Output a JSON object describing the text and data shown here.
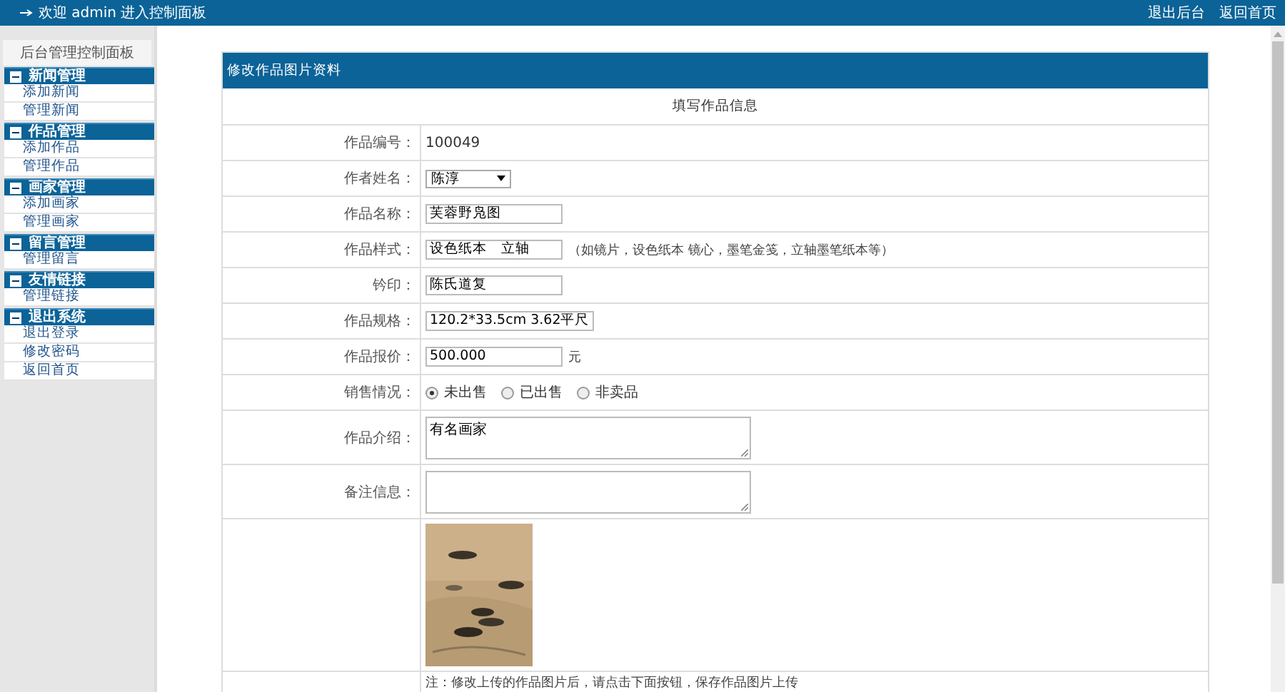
{
  "top_bar": {
    "welcome": "欢迎 admin 进入控制面板",
    "links": [
      "退出后台",
      "返回首页"
    ]
  },
  "sidebar": {
    "title": "后台管理控制面板",
    "groups": [
      {
        "label": "新闻管理",
        "expanded": true,
        "items": [
          "添加新闻",
          "管理新闻"
        ]
      },
      {
        "label": "作品管理",
        "expanded": true,
        "items": [
          "添加作品",
          "管理作品"
        ]
      },
      {
        "label": "画家管理",
        "expanded": true,
        "items": [
          "添加画家",
          "管理画家"
        ]
      },
      {
        "label": "留言管理",
        "expanded": true,
        "items": [
          "管理留言"
        ]
      },
      {
        "label": "友情链接",
        "expanded": true,
        "items": [
          "管理链接"
        ]
      },
      {
        "label": "退出系统",
        "expanded": true,
        "items": [
          "退出登录",
          "修改密码",
          "返回首页"
        ]
      }
    ]
  },
  "form": {
    "title": "修改作品图片资料",
    "subtitle": "填写作品信息",
    "rows": [
      {
        "kind": "text",
        "label": "作品编号：",
        "value": "100049"
      },
      {
        "kind": "select",
        "label": "作者姓名：",
        "value": "陈淳"
      },
      {
        "kind": "input",
        "label": "作品名称：",
        "value": "芙蓉野凫图"
      },
      {
        "kind": "input",
        "label": "作品样式：",
        "value": "设色纸本　立轴",
        "hint": "（如镜片，设色纸本 镜心，墨笔金笺，立轴墨笔纸本等）"
      },
      {
        "kind": "input",
        "label": "钤印：",
        "value": "陈氏道复"
      },
      {
        "kind": "input",
        "label": "作品规格：",
        "value": "120.2*33.5cm 3.62平尺"
      },
      {
        "kind": "input",
        "label": "作品报价：",
        "value": "500.000",
        "hint": "元"
      },
      {
        "kind": "radio",
        "label": "销售情况：",
        "options": [
          {
            "label": "未出售",
            "selected": true
          },
          {
            "label": "已出售",
            "selected": false
          },
          {
            "label": "非卖品",
            "selected": false
          }
        ]
      },
      {
        "kind": "textarea",
        "label": "作品介绍：",
        "value": "有名画家"
      },
      {
        "kind": "textarea",
        "label": "备注信息："
      },
      {
        "kind": "picture"
      },
      {
        "kind": "note",
        "value": "注：修改上传的作品图片后，请点击下面按钮，保存作品图片上传"
      }
    ]
  }
}
